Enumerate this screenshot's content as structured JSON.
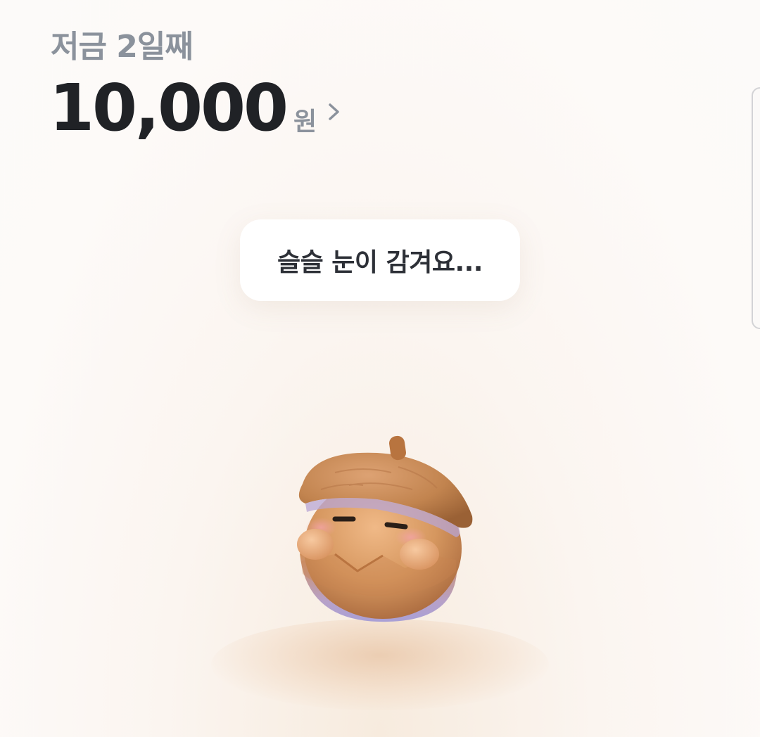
{
  "header": {
    "subtitle": "저금 2일째",
    "amount": "10,000",
    "currency": "원"
  },
  "bubble": {
    "message": "슬슬 눈이 감겨요..."
  },
  "icons": {
    "chevron": "chevron-right-icon",
    "character": "acorn-character-icon"
  },
  "colors": {
    "background": "#fcfaf9",
    "amount_text": "#202226",
    "muted_text": "#8b929c",
    "acorn_cap": "#c88a57",
    "acorn_body": "#d59a66"
  }
}
